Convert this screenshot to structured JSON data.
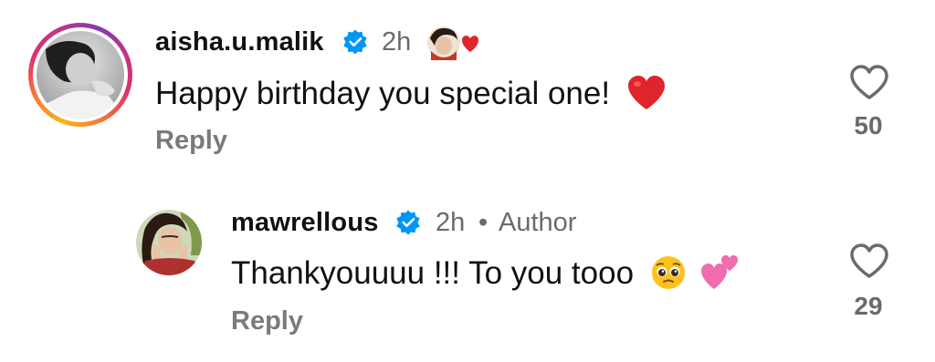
{
  "comments": [
    {
      "username": "aisha.u.malik",
      "time": "2h",
      "text": "Happy birthday you special one!",
      "reply_label": "Reply",
      "like_count": "50",
      "verified": true,
      "story_ring": true,
      "author_liked_badge": true
    },
    {
      "username": "mawrellous",
      "time": "2h",
      "separator": "•",
      "author_label": "Author",
      "text": "Thankyouuuu !!! To you tooo",
      "reply_label": "Reply",
      "like_count": "29",
      "verified": true
    }
  ],
  "colors": {
    "verified_blue": "#0095f6",
    "heart_red": "#e0242b",
    "muted": "#6b6b6b",
    "pink": "#f06bb0"
  },
  "icons": [
    "heart-outline-icon",
    "verified-badge-icon",
    "red-heart-emoji",
    "pleading-face-emoji",
    "two-hearts-emoji"
  ]
}
